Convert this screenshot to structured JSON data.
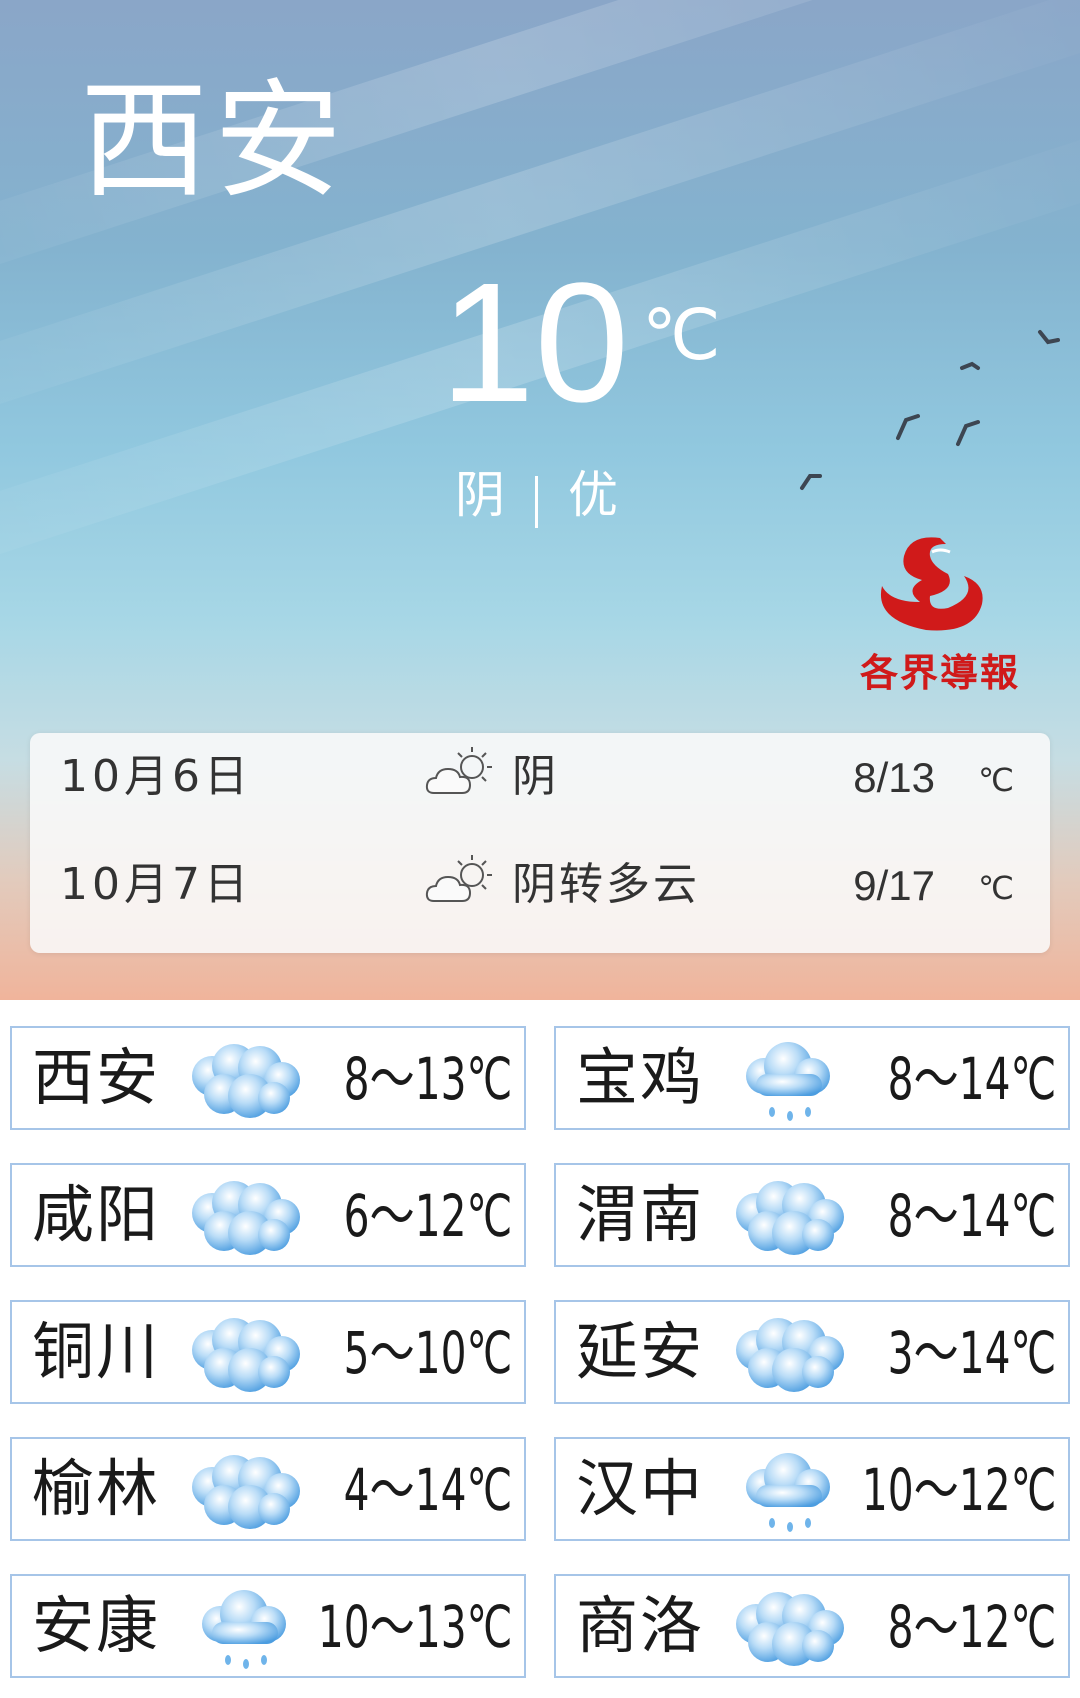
{
  "header": {
    "city": "西安",
    "temperature": "10",
    "unit": "℃",
    "condition": "阴",
    "air_quality": "优"
  },
  "logo": {
    "name": "各界導報",
    "color": "#d01a1a"
  },
  "forecast": [
    {
      "date": "10月6日",
      "icon": "cloudy-sun-icon",
      "condition": "阴",
      "range": "8/13",
      "unit": "℃"
    },
    {
      "date": "10月7日",
      "icon": "cloudy-sun-icon",
      "condition": "阴转多云",
      "range": "9/17",
      "unit": "℃"
    }
  ],
  "cities": [
    {
      "name": "西安",
      "icon": "overcast-icon",
      "range": "8～13℃"
    },
    {
      "name": "宝鸡",
      "icon": "light-rain-icon",
      "range": "8～14℃"
    },
    {
      "name": "咸阳",
      "icon": "overcast-icon",
      "range": "6～12℃"
    },
    {
      "name": "渭南",
      "icon": "overcast-icon",
      "range": "8～14℃"
    },
    {
      "name": "铜川",
      "icon": "overcast-icon",
      "range": "5～10℃"
    },
    {
      "name": "延安",
      "icon": "overcast-icon",
      "range": "3～14℃"
    },
    {
      "name": "榆林",
      "icon": "overcast-icon",
      "range": "4～14℃"
    },
    {
      "name": "汉中",
      "icon": "light-rain-icon",
      "range": "10～12℃"
    },
    {
      "name": "安康",
      "icon": "light-rain-icon",
      "range": "10～13℃"
    },
    {
      "name": "商洛",
      "icon": "overcast-icon",
      "range": "8～12℃"
    }
  ],
  "colors": {
    "cell_border": "#a6c5e8",
    "cloud": "#6fb4ea"
  }
}
